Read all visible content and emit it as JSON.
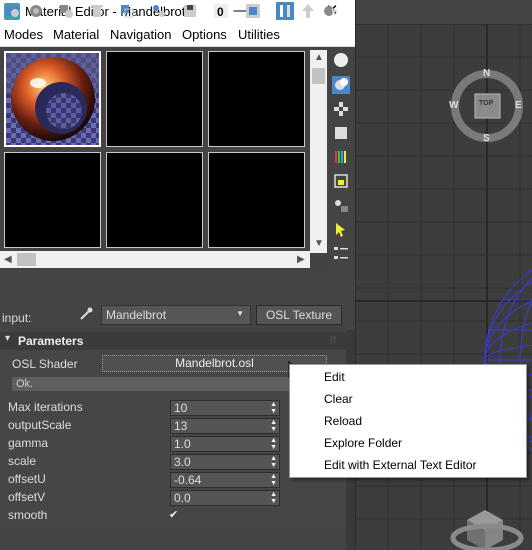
{
  "window": {
    "icon_glyph": "3",
    "title": "Material Editor - Mandelbrot",
    "minimize_glyph": "—",
    "maximize_glyph": "☐",
    "close_glyph": "✕"
  },
  "menubar": {
    "items": [
      "Modes",
      "Material",
      "Navigation",
      "Options",
      "Utilities"
    ]
  },
  "slots": {
    "count": 6,
    "active_index": 0
  },
  "input_row": {
    "label": "input:",
    "material_name": "Mandelbrot",
    "dropdown_arrow": "▼",
    "osl_texture_button": "OSL Texture"
  },
  "parameters": {
    "header": "Parameters",
    "collapse_glyph": "▾",
    "osl_shader_label": "OSL Shader",
    "osl_shader_file": "Mandelbrot.osl",
    "status_text": "Ok.",
    "fields": [
      {
        "label": "Max iterations",
        "value": "10"
      },
      {
        "label": "outputScale",
        "value": "13"
      },
      {
        "label": "gamma",
        "value": "1.0"
      },
      {
        "label": "scale",
        "value": "3.0"
      },
      {
        "label": "offsetU",
        "value": "-0.64"
      },
      {
        "label": "offsetV",
        "value": "0.0"
      }
    ],
    "smooth_label": "smooth",
    "smooth_checked": true,
    "smooth_glyph": "✔"
  },
  "context_menu": {
    "items": [
      "Edit",
      "Clear",
      "Reload",
      "Explore Folder",
      "Edit with External Text Editor"
    ]
  },
  "viewcube": {
    "face": "TOP",
    "north": "N",
    "south": "S",
    "east": "E",
    "west": "W"
  },
  "colors": {
    "ui_dark": "#444444",
    "viewport": "#3d3d3d",
    "grid": "#2f2f2f",
    "accent_blue": "#4a88c7",
    "wire": "#3b3bd6"
  }
}
